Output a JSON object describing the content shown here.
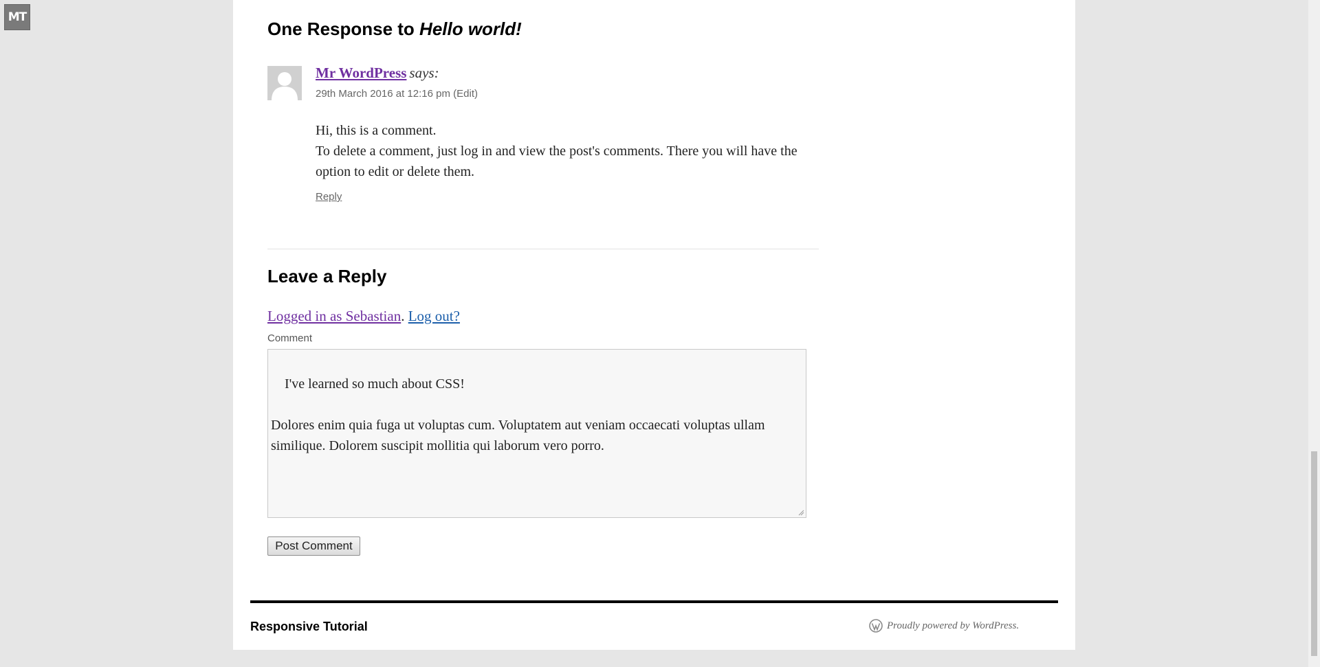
{
  "badge": {
    "text": "MT"
  },
  "comments": {
    "title_prefix": "One Response to ",
    "title_post": "Hello world!",
    "items": [
      {
        "author": "Mr WordPress",
        "says": "says:",
        "date": "29th March 2016 at 12:16 pm",
        "edit_label": "(Edit)",
        "body_line1": "Hi, this is a comment.",
        "body_line2": "To delete a comment, just log in and view the post's comments. There you will have the option to edit or delete them.",
        "reply_label": "Reply"
      }
    ]
  },
  "reply_form": {
    "title": "Leave a Reply",
    "logged_in_label": "Logged in as Sebastian",
    "separator": ". ",
    "logout_label": "Log out?",
    "comment_label": "Comment",
    "comment_value": "I've learned so much about CSS!\n\nDolores enim quia fuga ut voluptas cum. Voluptatem aut veniam occaecati voluptas ullam similique. Dolorem suscipit mollitia qui laborum vero porro.",
    "submit_label": "Post Comment"
  },
  "footer": {
    "site_name": "Responsive Tutorial",
    "powered_by": "Proudly powered by WordPress.",
    "icon": "wordpress-icon"
  },
  "colors": {
    "visited_link": "#6f2fa0",
    "link": "#1b5eaa",
    "page_background": "#e6e6e6"
  }
}
